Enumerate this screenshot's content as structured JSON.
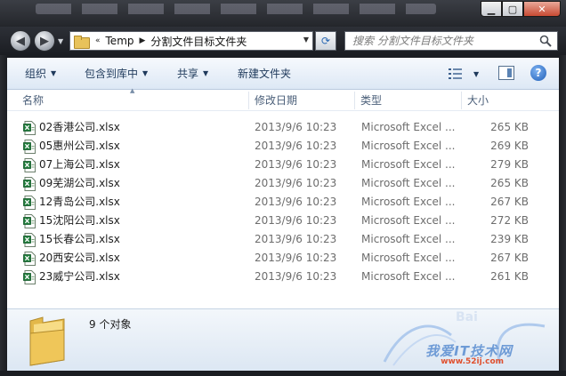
{
  "address": {
    "overflow": "«",
    "crumbs": [
      "Temp",
      "分割文件目标文件夹"
    ]
  },
  "search": {
    "placeholder": "搜索 分割文件目标文件夹"
  },
  "toolbar": {
    "organize": "组织",
    "include_in_library": "包含到库中",
    "share": "共享",
    "new_folder": "新建文件夹"
  },
  "columns": {
    "name": "名称",
    "date": "修改日期",
    "type": "类型",
    "size": "大小"
  },
  "files": [
    {
      "name": "02香港公司.xlsx",
      "date": "2013/9/6 10:23",
      "type": "Microsoft Excel ...",
      "size": "265 KB"
    },
    {
      "name": "05惠州公司.xlsx",
      "date": "2013/9/6 10:23",
      "type": "Microsoft Excel ...",
      "size": "269 KB"
    },
    {
      "name": "07上海公司.xlsx",
      "date": "2013/9/6 10:23",
      "type": "Microsoft Excel ...",
      "size": "279 KB"
    },
    {
      "name": "09芜湖公司.xlsx",
      "date": "2013/9/6 10:23",
      "type": "Microsoft Excel ...",
      "size": "265 KB"
    },
    {
      "name": "12青岛公司.xlsx",
      "date": "2013/9/6 10:23",
      "type": "Microsoft Excel ...",
      "size": "267 KB"
    },
    {
      "name": "15沈阳公司.xlsx",
      "date": "2013/9/6 10:23",
      "type": "Microsoft Excel ...",
      "size": "272 KB"
    },
    {
      "name": "15长春公司.xlsx",
      "date": "2013/9/6 10:23",
      "type": "Microsoft Excel ...",
      "size": "239 KB"
    },
    {
      "name": "20西安公司.xlsx",
      "date": "2013/9/6 10:23",
      "type": "Microsoft Excel ...",
      "size": "267 KB"
    },
    {
      "name": "23威宁公司.xlsx",
      "date": "2013/9/6 10:23",
      "type": "Microsoft Excel ...",
      "size": "261 KB"
    }
  ],
  "status": {
    "count_text": "9 个对象"
  },
  "watermark": {
    "text": "我爱IT技术网",
    "url": "www.52ij.com"
  },
  "icons": {
    "back": "back-arrow-icon",
    "forward": "forward-arrow-icon",
    "refresh": "refresh-icon",
    "search": "search-icon",
    "excel": "excel-file-icon",
    "folder": "folder-icon",
    "help": "help-icon"
  },
  "colors": {
    "toolbar_text": "#1e395b",
    "accent": "#2b69b3",
    "frame": "#1b1d22"
  }
}
